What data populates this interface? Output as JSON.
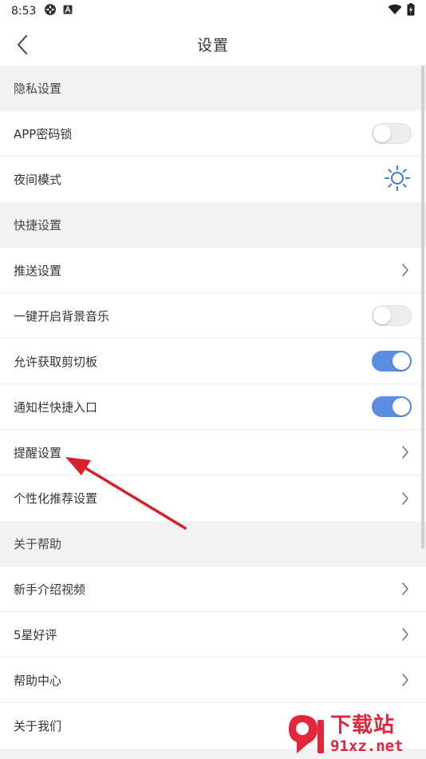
{
  "status_bar": {
    "time": "8:53"
  },
  "header": {
    "title": "设置"
  },
  "sections": [
    {
      "title": "隐私设置",
      "items": [
        {
          "label": "APP密码锁",
          "control": "toggle",
          "on": false
        },
        {
          "label": "夜间模式",
          "control": "sun-icon"
        }
      ]
    },
    {
      "title": "快捷设置",
      "items": [
        {
          "label": "推送设置",
          "control": "chevron"
        },
        {
          "label": "一键开启背景音乐",
          "control": "toggle",
          "on": false
        },
        {
          "label": "允许获取剪切板",
          "control": "toggle",
          "on": true
        },
        {
          "label": "通知栏快捷入口",
          "control": "toggle",
          "on": true
        },
        {
          "label": "提醒设置",
          "control": "chevron"
        },
        {
          "label": "个性化推荐设置",
          "control": "chevron"
        }
      ]
    },
    {
      "title": "关于帮助",
      "items": [
        {
          "label": "新手介绍视频",
          "control": "chevron"
        },
        {
          "label": "5星好评",
          "control": "chevron"
        },
        {
          "label": "帮助中心",
          "control": "chevron"
        },
        {
          "label": "关于我们",
          "control": "none"
        }
      ]
    }
  ],
  "watermark": {
    "main": "下载站",
    "sub": "91xz.net"
  },
  "colors": {
    "accent": "#5b8de0",
    "sun": "#3a7bd5",
    "arrow": "#d9202a",
    "watermark": "#e3263c"
  }
}
